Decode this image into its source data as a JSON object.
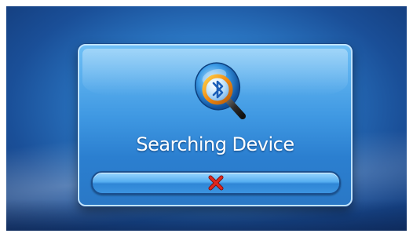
{
  "dialog": {
    "status_text": "Searching Device",
    "icon": "bluetooth-search-icon",
    "cancel_icon": "close-x-icon"
  },
  "colors": {
    "background": "#1a4f98",
    "dialog": "#3f98e2",
    "button": "#55aef0",
    "cancel_x": "#d2201c"
  }
}
